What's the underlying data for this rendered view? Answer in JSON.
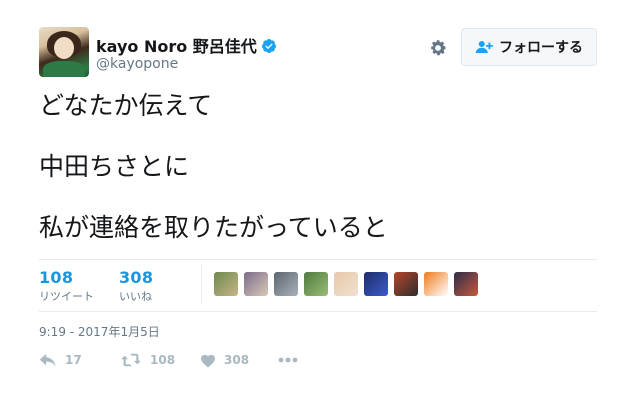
{
  "user": {
    "name": "kayo Noro 野呂佳代",
    "handle": "@kayopone"
  },
  "header": {
    "follow_label": "フォローする"
  },
  "tweet": {
    "lines": [
      "どなたか伝えて",
      "中田ちさとに",
      "私が連絡を取りたがっていると"
    ],
    "timestamp": "9:19 - 2017年1月5日"
  },
  "stats": {
    "retweets": {
      "count": "108",
      "label": "リツイート"
    },
    "likes": {
      "count": "308",
      "label": "いいね"
    }
  },
  "likers": [
    {
      "colors": [
        "#6d8a4c",
        "#c9b48a"
      ]
    },
    {
      "colors": [
        "#7a6c8c",
        "#d9c9b6"
      ]
    },
    {
      "colors": [
        "#5d6570",
        "#a9b1b8"
      ]
    },
    {
      "colors": [
        "#4f7a3e",
        "#9bbd77"
      ]
    },
    {
      "colors": [
        "#e7c9a8",
        "#f0e0d0"
      ]
    },
    {
      "colors": [
        "#1f2c6b",
        "#3b5cc9"
      ]
    },
    {
      "colors": [
        "#b8452a",
        "#2d2d2d"
      ]
    },
    {
      "colors": [
        "#f07a1a",
        "#ffffff"
      ]
    },
    {
      "colors": [
        "#2b2f4a",
        "#c8563e"
      ]
    }
  ],
  "actions": {
    "reply": {
      "icon": "reply-icon",
      "count": "17"
    },
    "retweet": {
      "icon": "retweet-icon",
      "count": "108"
    },
    "like": {
      "icon": "heart-icon",
      "count": "308"
    },
    "more": {
      "icon": "more-icon"
    }
  },
  "colors": {
    "link": "#1b95e0",
    "muted": "#657786",
    "icon": "#aab8c2",
    "verified": "#1da1f2"
  }
}
